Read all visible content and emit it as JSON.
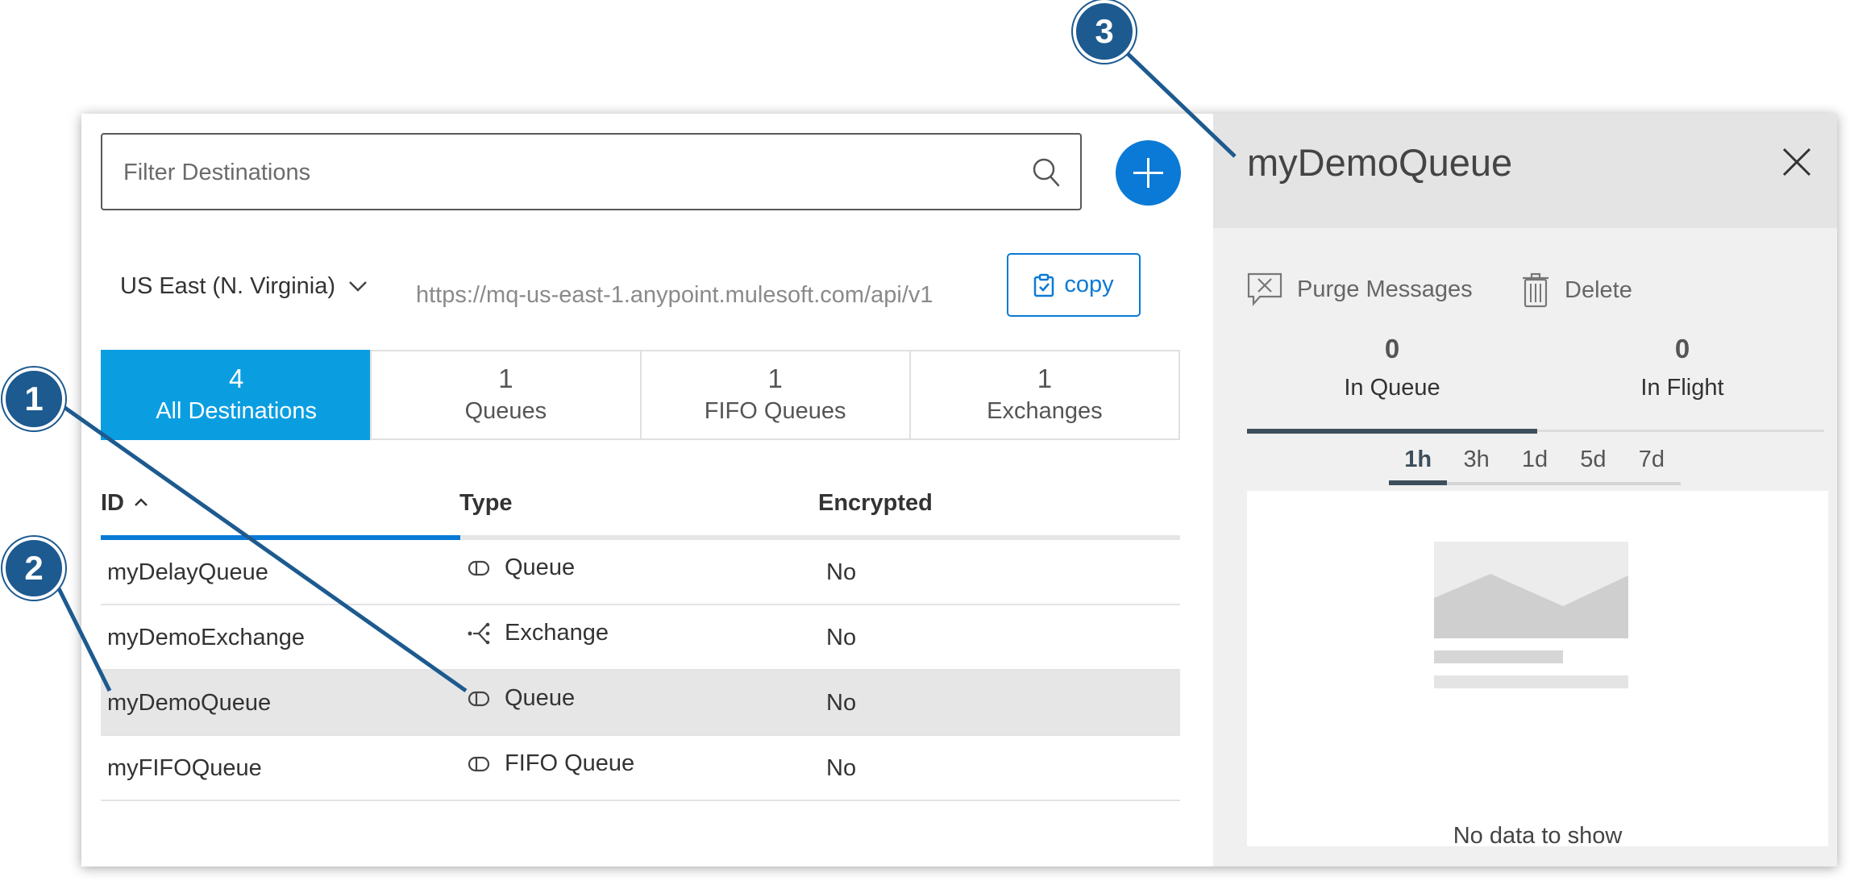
{
  "filter": {
    "placeholder": "Filter Destinations",
    "value": ""
  },
  "region": {
    "selected": "US East (N. Virginia)"
  },
  "endpoint_url": "https://mq-us-east-1.anypoint.mulesoft.com/api/v1",
  "copy_label": "copy",
  "tabs": [
    {
      "count": "4",
      "label": "All Destinations",
      "active": true
    },
    {
      "count": "1",
      "label": "Queues",
      "active": false
    },
    {
      "count": "1",
      "label": "FIFO Queues",
      "active": false
    },
    {
      "count": "1",
      "label": "Exchanges",
      "active": false
    }
  ],
  "table": {
    "headers": {
      "id": "ID",
      "type": "Type",
      "encrypted": "Encrypted"
    },
    "sort": {
      "column": "ID",
      "direction": "ascending"
    },
    "rows": [
      {
        "id": "myDelayQueue",
        "type": "Queue",
        "type_icon": "queue-icon",
        "encrypted": "No"
      },
      {
        "id": "myDemoExchange",
        "type": "Exchange",
        "type_icon": "exchange-icon",
        "encrypted": "No"
      },
      {
        "id": "myDemoQueue",
        "type": "Queue",
        "type_icon": "queue-icon",
        "encrypted": "No",
        "selected": true
      },
      {
        "id": "myFIFOQueue",
        "type": "FIFO Queue",
        "type_icon": "queue-icon",
        "encrypted": "No"
      }
    ]
  },
  "detail": {
    "title": "myDemoQueue",
    "actions": {
      "purge": "Purge Messages",
      "delete": "Delete"
    },
    "metrics": [
      {
        "value": "0",
        "label": "In Queue",
        "active": true
      },
      {
        "value": "0",
        "label": "In Flight",
        "active": false
      }
    ],
    "ranges": [
      "1h",
      "3h",
      "1d",
      "5d",
      "7d"
    ],
    "active_range": "1h",
    "empty_text": "No data to show"
  },
  "callouts": [
    "1",
    "2",
    "3"
  ],
  "colors": {
    "accent_blue": "#0a7ad6",
    "active_tab": "#0a9ee1",
    "callout": "#1d5a8f",
    "selected_row": "#e6e6e6"
  }
}
